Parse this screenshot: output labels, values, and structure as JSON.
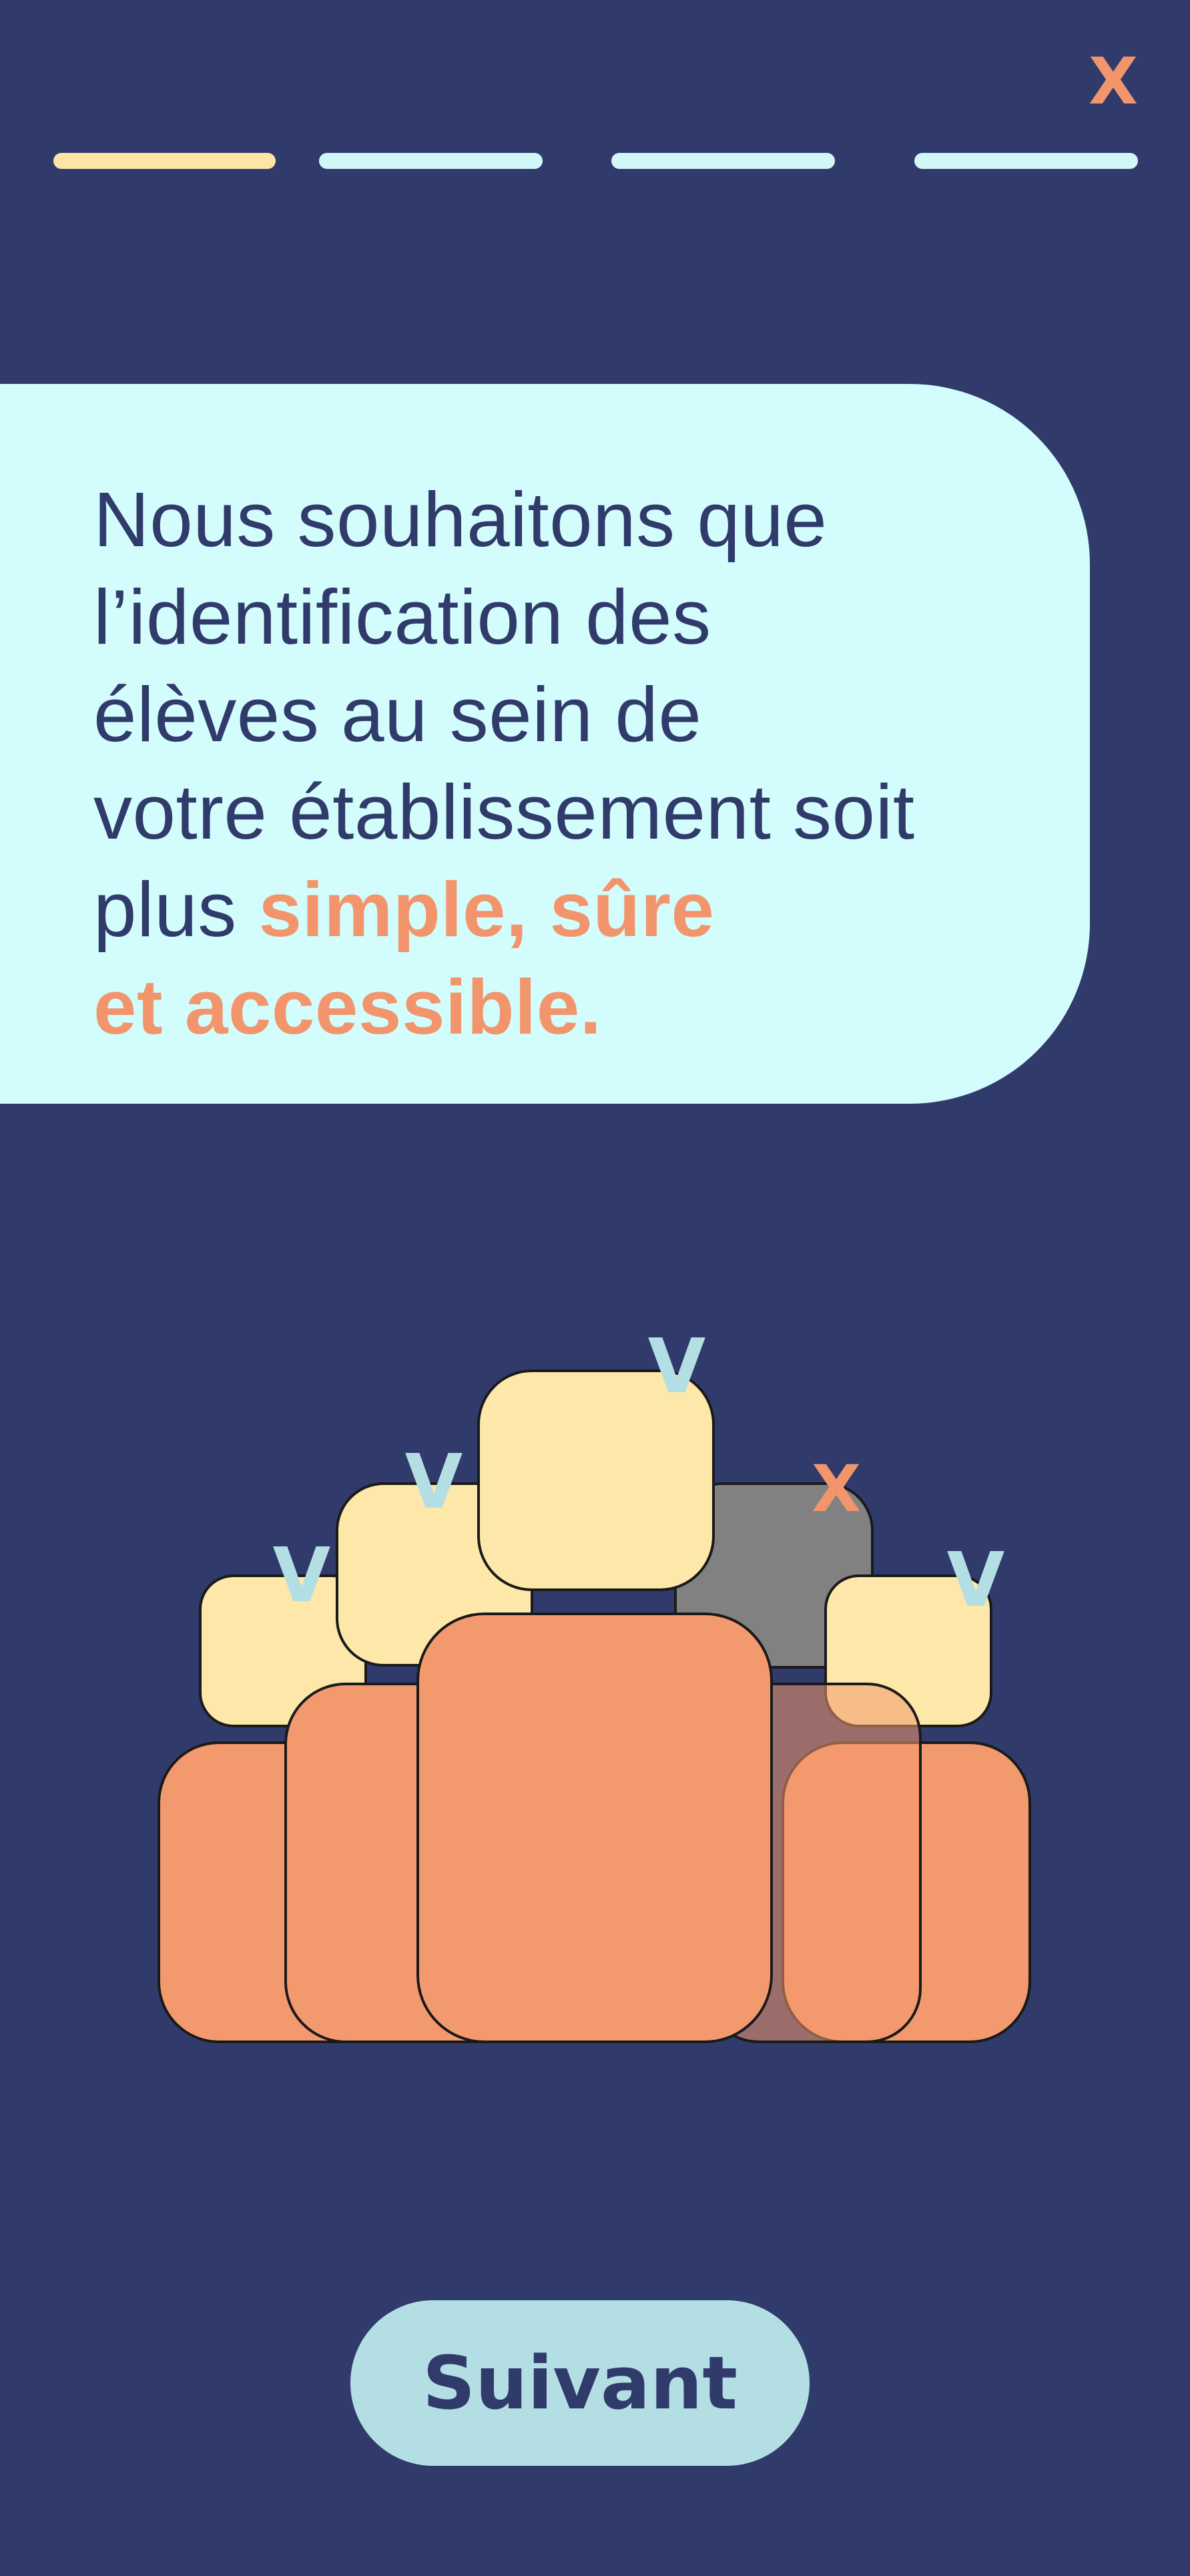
{
  "header": {
    "close_label": "X",
    "progress": {
      "total_steps": 4,
      "current_step": 1
    }
  },
  "intro": {
    "line1": "Nous souhaitons que",
    "line2": "l’identification des",
    "line3": "élèves au sein de",
    "line4": "votre établissement soit",
    "line5_plain": "plus ",
    "line5_highlight": "simple, sûre",
    "line6_highlight": "et accessible."
  },
  "illustration": {
    "check_mark": "V",
    "cross_mark": "X",
    "icon": "students-group-illustration"
  },
  "footer": {
    "next_label": "Suivant"
  },
  "colors": {
    "background": "#313b6b",
    "bubble": "#d2fdfc",
    "accent": "#f2956c",
    "progress_active": "#fce5a5",
    "progress_inactive": "#d2f7f8",
    "head": "#fde8a9",
    "body": "#f3996e",
    "check": "#b3dfe4",
    "button": "#b3dfe4"
  }
}
